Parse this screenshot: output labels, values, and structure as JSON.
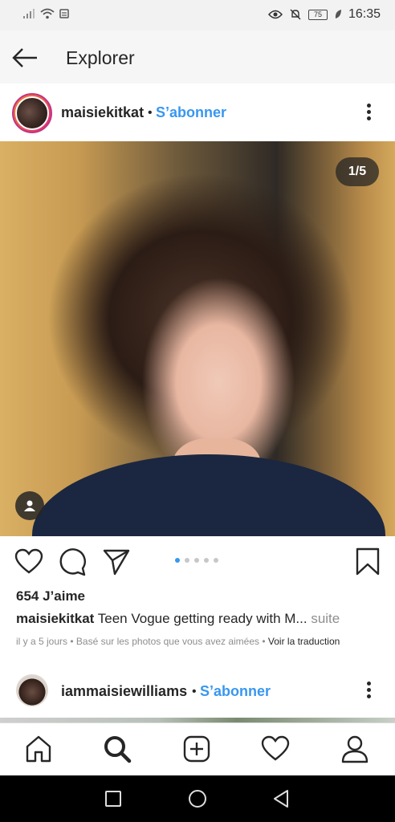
{
  "status_bar": {
    "time": "16:35",
    "battery": "75",
    "icons": [
      "signal-icon",
      "wifi-icon",
      "sim-icon",
      "eye-icon",
      "mute-icon",
      "battery-icon",
      "leaf-icon"
    ]
  },
  "header": {
    "back_icon": "back-arrow-icon",
    "title": "Explorer"
  },
  "post": {
    "username": "maisiekitkat",
    "separator": "•",
    "follow_label": "S’abonner",
    "more_icon": "more-vertical-icon",
    "image_counter": "1/5",
    "carousel": {
      "current": 1,
      "total": 5
    },
    "likes": "654 J’aime",
    "caption_user": "maisiekitkat",
    "caption_text": "Teen Vogue getting ready with M...",
    "caption_more": "suite",
    "meta_text": "il y a 5 jours • Basé sur les photos que vous avez aimées •",
    "translate_label": "Voir la traduction"
  },
  "next_post": {
    "username": "iammaisiewilliams",
    "separator": "•",
    "follow_label": "S’abonner"
  },
  "tabbar": {
    "items": [
      "home-icon",
      "search-icon",
      "add-icon",
      "activity-icon",
      "profile-icon"
    ],
    "active": "search-icon"
  },
  "system_nav": [
    "recents-icon",
    "home-circle-icon",
    "back-triangle-icon"
  ],
  "colors": {
    "link": "#3897f0",
    "text": "#262626",
    "muted": "#8e8e8e"
  }
}
